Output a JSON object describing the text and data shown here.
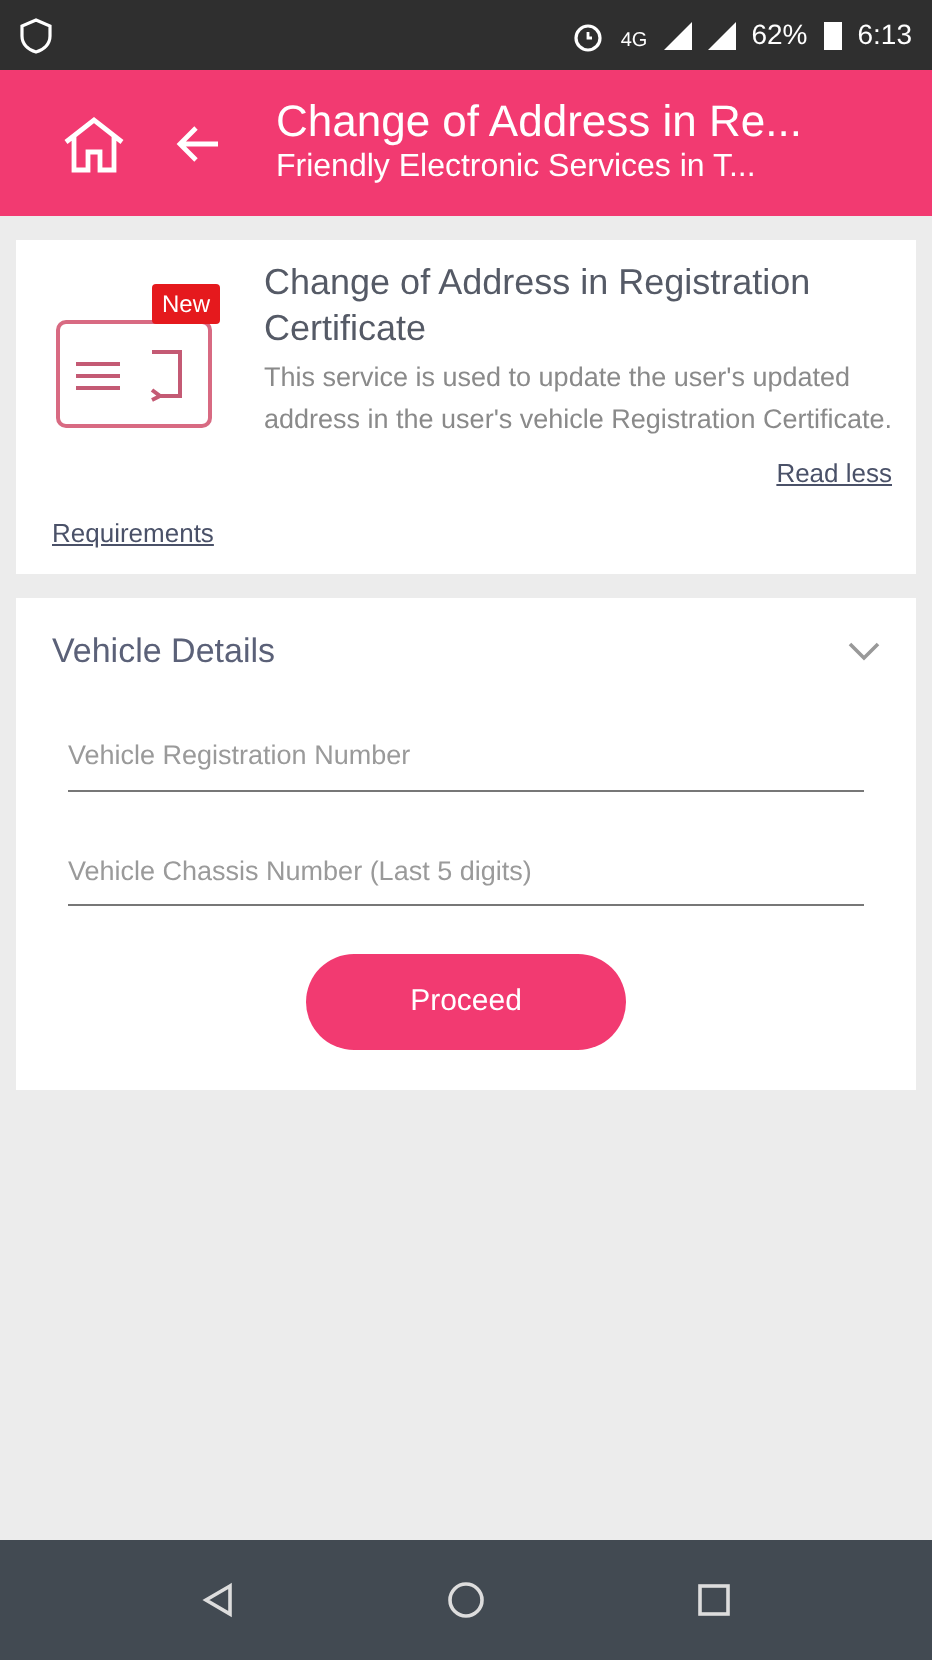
{
  "status_bar": {
    "network": "4G",
    "battery": "62%",
    "time": "6:13"
  },
  "header": {
    "title": "Change of Address in Re...",
    "subtitle": "Friendly Electronic Services in T..."
  },
  "service_card": {
    "badge": "New",
    "title": "Change of Address in Registration Certificate",
    "description": "This service is used to update the user's updated address in the user's vehicle Registration Certificate.",
    "read_less": "Read less",
    "requirements": "Requirements"
  },
  "vehicle_details": {
    "heading": "Vehicle Details",
    "fields": [
      {
        "placeholder": "Vehicle Registration Number"
      },
      {
        "placeholder": "Vehicle Chassis Number (Last 5 digits)"
      }
    ],
    "button": "Proceed"
  }
}
